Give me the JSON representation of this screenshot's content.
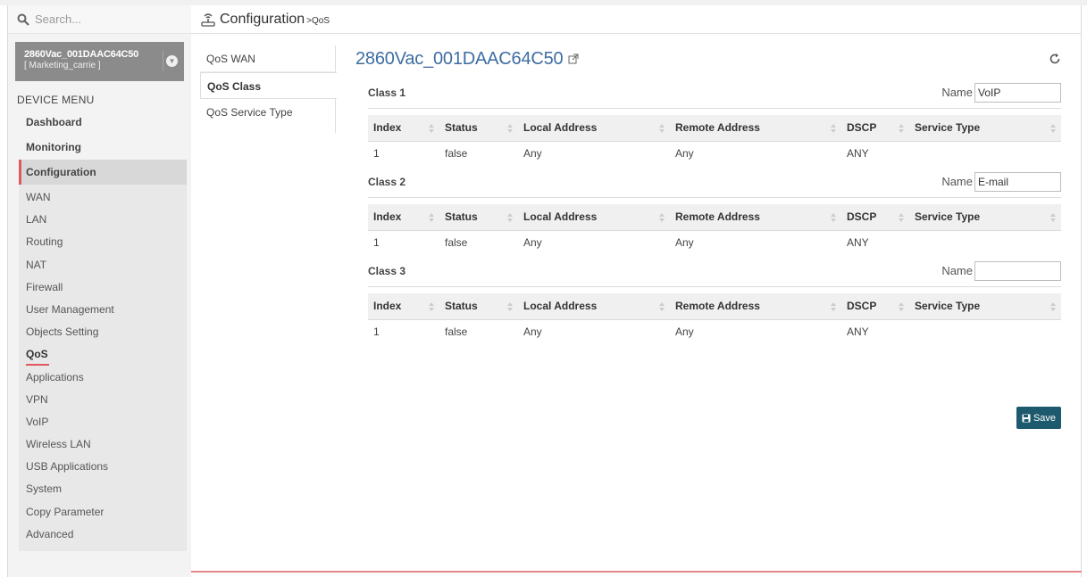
{
  "search": {
    "placeholder": "Search..."
  },
  "device": {
    "name": "2860Vac_001DAAC64C50",
    "group": "[ Marketing_carrie ]"
  },
  "menu": {
    "title": "DEVICE MENU",
    "main": [
      {
        "label": "Dashboard"
      },
      {
        "label": "Monitoring"
      },
      {
        "label": "Configuration"
      }
    ],
    "sub": [
      {
        "label": "WAN"
      },
      {
        "label": "LAN"
      },
      {
        "label": "Routing"
      },
      {
        "label": "NAT"
      },
      {
        "label": "Firewall"
      },
      {
        "label": "User Management"
      },
      {
        "label": "Objects Setting"
      },
      {
        "label": "QoS"
      },
      {
        "label": "Applications"
      },
      {
        "label": "VPN"
      },
      {
        "label": "VoIP"
      },
      {
        "label": "Wireless LAN"
      },
      {
        "label": "USB Applications"
      },
      {
        "label": "System"
      },
      {
        "label": "Copy Parameter"
      },
      {
        "label": "Advanced"
      }
    ]
  },
  "breadcrumb": {
    "title": "Configuration",
    "sub": ">QoS"
  },
  "tabs": [
    {
      "label": "QoS WAN"
    },
    {
      "label": "QoS Class"
    },
    {
      "label": "QoS Service Type"
    }
  ],
  "page": {
    "device_title": "2860Vac_001DAAC64C50"
  },
  "table_headers": [
    "Index",
    "Status",
    "Local Address",
    "Remote Address",
    "DSCP",
    "Service Type"
  ],
  "name_label": "Name",
  "classes": [
    {
      "title": "Class 1",
      "name_value": "VoIP",
      "rows": [
        {
          "index": "1",
          "status": "false",
          "local": "Any",
          "remote": "Any",
          "dscp": "ANY",
          "service": ""
        }
      ]
    },
    {
      "title": "Class 2",
      "name_value": "E-mail",
      "rows": [
        {
          "index": "1",
          "status": "false",
          "local": "Any",
          "remote": "Any",
          "dscp": "ANY",
          "service": ""
        }
      ]
    },
    {
      "title": "Class 3",
      "name_value": "",
      "rows": [
        {
          "index": "1",
          "status": "false",
          "local": "Any",
          "remote": "Any",
          "dscp": "ANY",
          "service": ""
        }
      ]
    }
  ],
  "save_label": "Save",
  "colors": {
    "accent": "#e0585f",
    "title_blue": "#3e6da2",
    "save_bg": "#1e5a6e"
  }
}
